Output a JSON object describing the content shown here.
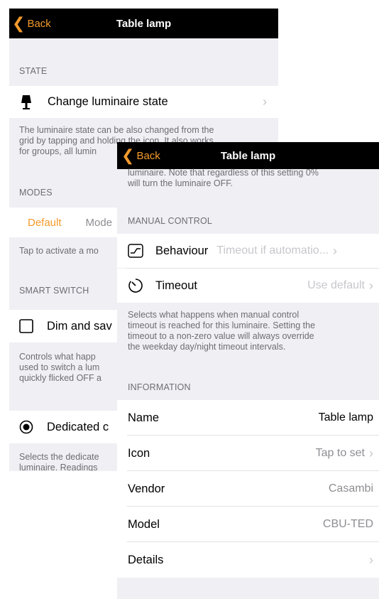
{
  "back_screen": {
    "nav": {
      "back_label": "Back",
      "title": "Table lamp"
    },
    "state_header": "STATE",
    "state_row_label": "Change luminaire state",
    "state_footer": [
      "The luminaire state can be also changed from the",
      "grid by tapping and holding the icon. It also works",
      "for groups, all lumin"
    ],
    "modes_header": "MODES",
    "modes_tabs": [
      "Default",
      "Mode"
    ],
    "modes_footer": "Tap to activate a mo",
    "smart_switch_header": "SMART SWITCH",
    "dim_row_label": "Dim and sav",
    "smart_footer": [
      "Controls what happ",
      "used to switch a lum",
      "quickly flicked OFF a"
    ],
    "dedicated_row_label": "Dedicated c",
    "dedicated_footer": [
      "Selects the dedicate",
      "luminaire. Readings"
    ]
  },
  "front_screen": {
    "nav": {
      "back_label": "Back",
      "title": "Table lamp"
    },
    "top_text": [
      "luminaire. Note that regardless of this setting 0%",
      "will turn the luminaire OFF."
    ],
    "manual_header": "MANUAL CONTROL",
    "behaviour": {
      "label": "Behaviour",
      "value": "Timeout if automatio..."
    },
    "timeout": {
      "label": "Timeout",
      "value": "Use default"
    },
    "manual_footer": [
      "Selects what happens when manual control",
      "timeout is reached for this luminaire. Setting the",
      "timeout to a non-zero value will always override",
      "the weekday day/night timeout intervals."
    ],
    "info_header": "INFORMATION",
    "info_rows": [
      {
        "label": "Name",
        "value": "Table lamp"
      },
      {
        "label": "Icon",
        "value": "Tap to set"
      },
      {
        "label": "Vendor",
        "value": "Casambi"
      },
      {
        "label": "Model",
        "value": "CBU-TED"
      },
      {
        "label": "Details",
        "value": ""
      }
    ]
  },
  "colors": {
    "accent": "#f39a2b",
    "nav_bg": "#000000",
    "group_bg": "#efeff4"
  }
}
